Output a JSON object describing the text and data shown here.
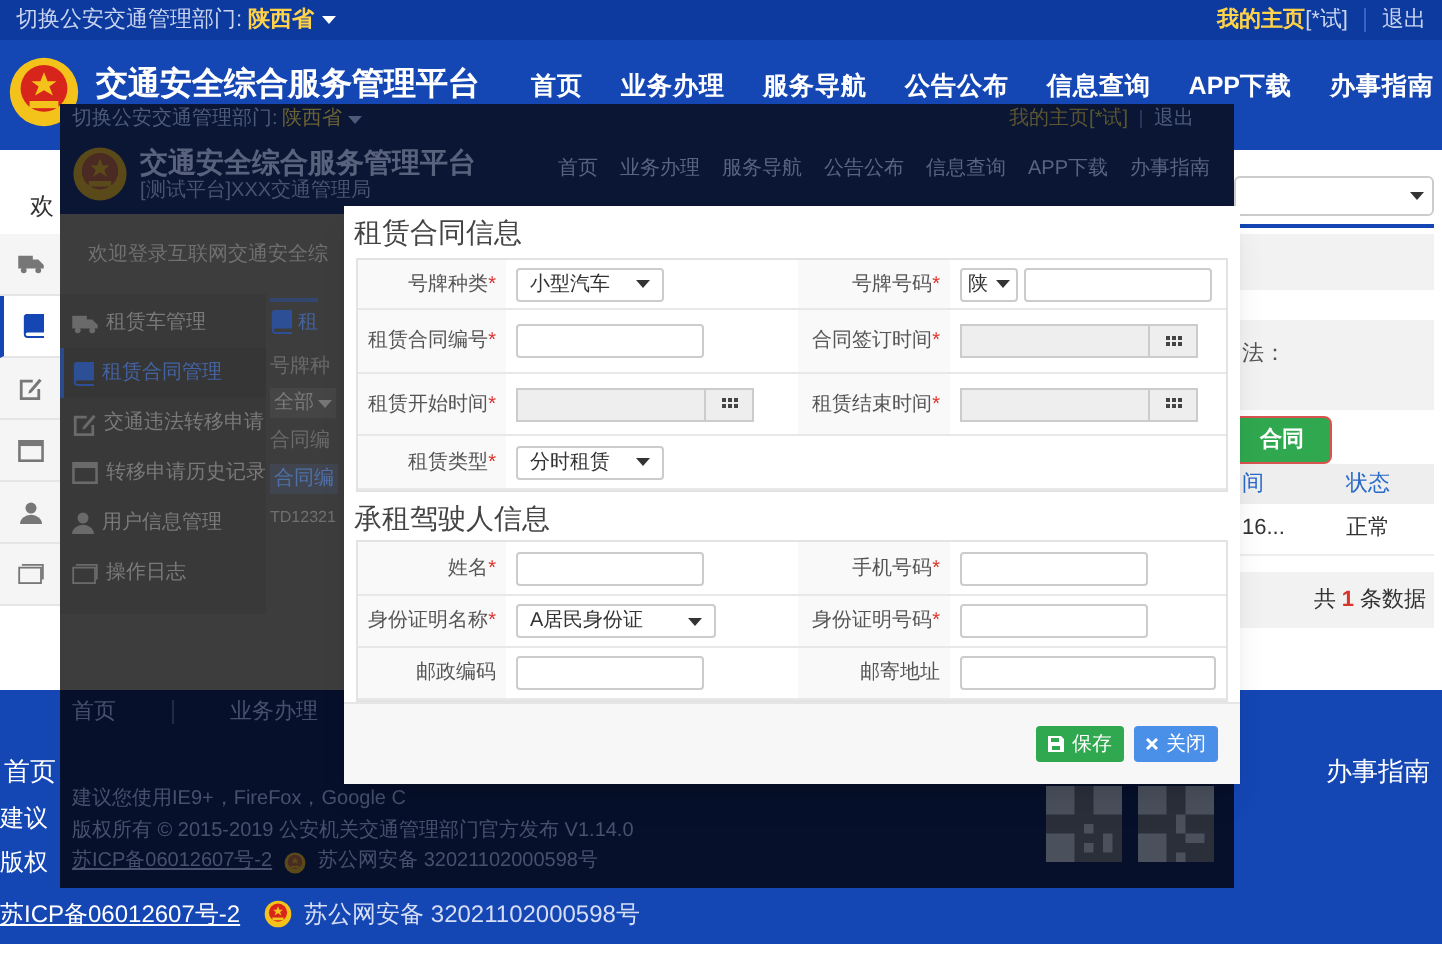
{
  "top_bar": {
    "switch_label": "切换公安交通管理部门:",
    "province": "陕西省",
    "home_link": "我的主页",
    "user": "[*试]",
    "logout": "退出"
  },
  "header": {
    "title": "交通安全综合服务管理平台",
    "nav": [
      "首页",
      "业务办理",
      "服务导航",
      "公告公布",
      "信息查询",
      "APP下载",
      "办事指南"
    ]
  },
  "welcome": "欢",
  "side_icons": [
    {
      "kind": "truck",
      "selected": false
    },
    {
      "kind": "book",
      "selected": true
    },
    {
      "kind": "edit",
      "selected": false
    },
    {
      "kind": "calendar",
      "selected": false
    },
    {
      "kind": "user",
      "selected": false
    },
    {
      "kind": "card",
      "selected": false
    }
  ],
  "right_panel": {
    "filter_label": "法：",
    "add_button": "合同",
    "columns": [
      "间",
      "状态"
    ],
    "row": [
      "16...",
      "正常"
    ],
    "total_prefix": "共",
    "total_count": "1",
    "total_suffix": "条数据"
  },
  "footer": {
    "nav_first": "首页",
    "nav_last": "办事指南",
    "line_1": "建议",
    "line_2": "版权",
    "icp": "苏ICP备06012607号-2",
    "police": "苏公网安备 32021102000598号"
  },
  "screenshot": {
    "top_bar": {
      "switch_label": "切换公安交通管理部门:",
      "province": "陕西省",
      "home_link": "我的主页[*试]",
      "logout": "退出"
    },
    "header": {
      "title": "交通安全综合服务管理平台",
      "subtitle": "[测试平台]XXX交通管理局",
      "nav": [
        "首页",
        "业务办理",
        "服务导航",
        "公告公布",
        "信息查询",
        "APP下载",
        "办事指南"
      ]
    },
    "welcome": "欢迎登录互联网交通安全综",
    "menu": [
      {
        "kind": "truck",
        "label": "租赁车管理",
        "selected": false
      },
      {
        "kind": "book",
        "label": "租赁合同管理",
        "selected": true
      },
      {
        "kind": "edit",
        "label": "交通违法转移申请",
        "selected": false
      },
      {
        "kind": "calendar",
        "label": "转移申请历史记录",
        "selected": false
      },
      {
        "kind": "user",
        "label": "用户信息管理",
        "selected": false
      },
      {
        "kind": "card",
        "label": "操作日志",
        "selected": false
      }
    ],
    "content": {
      "tab": "租",
      "filter_label": "号牌种",
      "filter_value": "全部",
      "contract_label": "合同编",
      "column": "合同编",
      "cell": "TD12321"
    },
    "footer": {
      "nav": [
        "首页",
        "业务办理"
      ],
      "browser_note": "建议您使用IE9+，FireFox，Google C",
      "copyright": "版权所有 © 2015-2019 公安机关交通管理部门官方发布 V1.14.0",
      "icp": "苏ICP备06012607号-2",
      "police": "苏公网安备 32021102000598号"
    }
  },
  "dialog": {
    "sections": [
      {
        "title": "租赁合同信息",
        "rows": [
          [
            {
              "label": "号牌种类",
              "mark": "*",
              "kind": "select",
              "value": "小型汽车"
            },
            {
              "label": "号牌号码",
              "mark": "*",
              "kind": "plate",
              "prefix": "陕"
            }
          ],
          [
            {
              "label": "租赁合同编号",
              "mark": "*",
              "kind": "text"
            },
            {
              "label": "合同签订时间",
              "mark": "*",
              "kind": "date"
            }
          ],
          [
            {
              "label": "租赁开始时间",
              "mark": "*",
              "kind": "date"
            },
            {
              "label": "租赁结束时间",
              "mark": "*",
              "kind": "date"
            }
          ],
          [
            {
              "label": "租赁类型",
              "mark": "*",
              "kind": "select",
              "value": "分时租赁"
            }
          ]
        ]
      },
      {
        "title": "承租驾驶人信息",
        "rows": [
          [
            {
              "label": "姓名",
              "mark": "*",
              "kind": "text"
            },
            {
              "label": "手机号码",
              "mark": "*",
              "kind": "text"
            }
          ],
          [
            {
              "label": "身份证明名称",
              "mark": "*",
              "kind": "select",
              "value": "A居民身份证",
              "wide": true
            },
            {
              "label": "身份证明号码",
              "mark": "*",
              "kind": "text"
            }
          ],
          [
            {
              "label": "邮政编码",
              "kind": "text"
            },
            {
              "label": "邮寄地址",
              "kind": "text",
              "wide": true
            }
          ]
        ]
      }
    ],
    "buttons": [
      {
        "kind": "save",
        "label": "保存"
      },
      {
        "kind": "close",
        "label": "关闭"
      }
    ]
  }
}
